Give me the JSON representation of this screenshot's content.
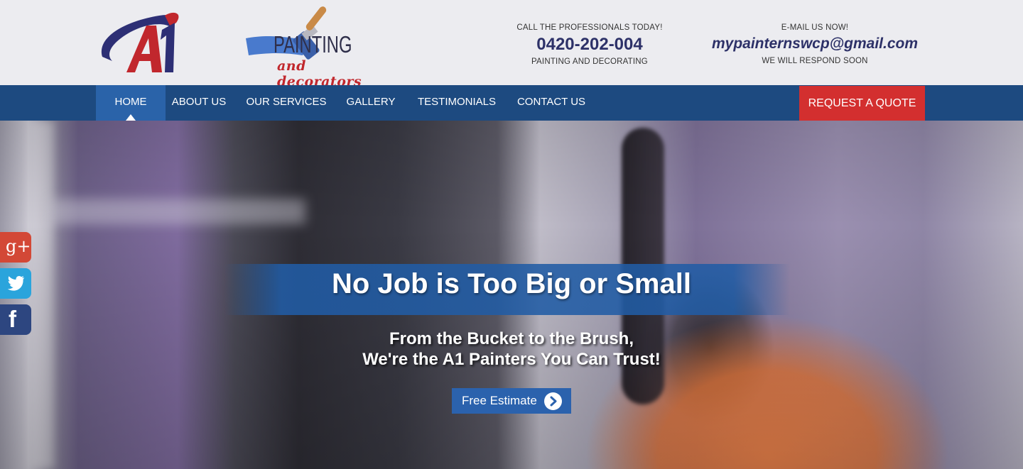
{
  "logo": {
    "initials": "A1",
    "word": "PAINTING",
    "tagline": "and decorators"
  },
  "header": {
    "phone": {
      "heading": "CALL THE PROFESSIONALS TODAY!",
      "number": "0420-202-004",
      "caption": "PAINTING AND DECORATING"
    },
    "email": {
      "heading": "E-MAIL US NOW!",
      "address": "mypainternswcp@gmail.com",
      "caption": "WE WILL RESPOND SOON"
    }
  },
  "nav": {
    "items": [
      {
        "label": "HOME",
        "active": true
      },
      {
        "label": "ABOUT US"
      },
      {
        "label": "OUR SERVICES"
      },
      {
        "label": "GALLERY"
      },
      {
        "label": "TESTIMONIALS"
      },
      {
        "label": "CONTACT US"
      }
    ],
    "quote_label": "REQUEST A QUOTE"
  },
  "hero": {
    "headline": "No Job is Too Big or Small",
    "subline": "From the Bucket to the Brush,\nWe're the A1  Painters You Can Trust!",
    "cta_label": "Free Estimate"
  },
  "social": {
    "googleplus": "g+",
    "twitter_icon": "twitter-bird-icon",
    "facebook": "f"
  },
  "colors": {
    "nav_bg": "#1d4a80",
    "nav_active": "#2a63a9",
    "quote_bg": "#d32f2f",
    "brand_red": "#c1272d",
    "brand_navy": "#2d3168"
  }
}
